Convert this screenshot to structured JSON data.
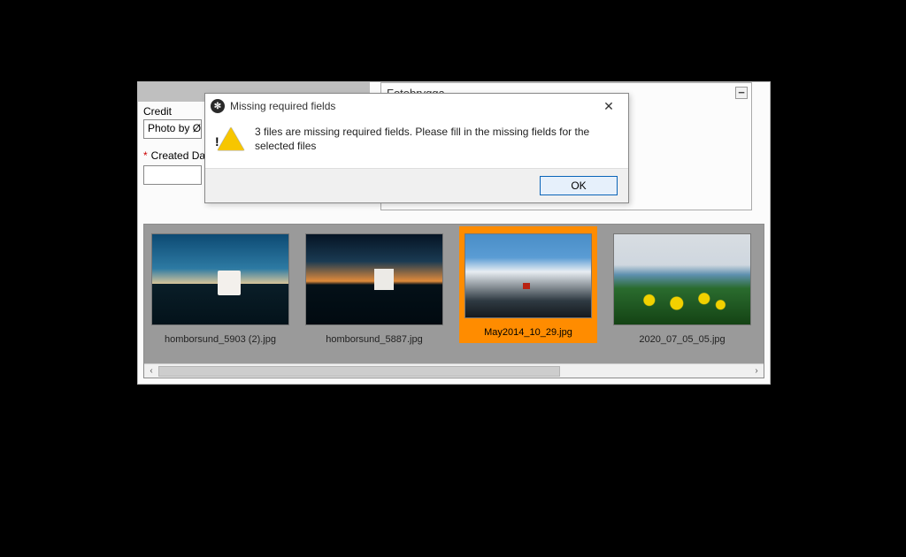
{
  "form": {
    "top_right_value": "Fotobrygga",
    "credit_label": "Credit",
    "credit_value": "Photo by Øys",
    "created_label": "Created Da",
    "required_marker": "*",
    "minus_label": "−"
  },
  "dialog": {
    "title": "Missing required fields",
    "message": "3 files are missing required fields. Please fill in the missing fields for the selected files",
    "ok": "OK",
    "close_label": "✕"
  },
  "thumbnails": [
    {
      "filename": "homborsund_5903 (2).jpg",
      "kind": "light1",
      "selected": false
    },
    {
      "filename": "homborsund_5887.jpg",
      "kind": "light2",
      "selected": false
    },
    {
      "filename": "May2014_10_29.jpg",
      "kind": "mountain",
      "selected": true
    },
    {
      "filename": "2020_07_05_05.jpg",
      "kind": "flowers",
      "selected": false
    }
  ],
  "scroll": {
    "left_glyph": "‹",
    "right_glyph": "›"
  }
}
